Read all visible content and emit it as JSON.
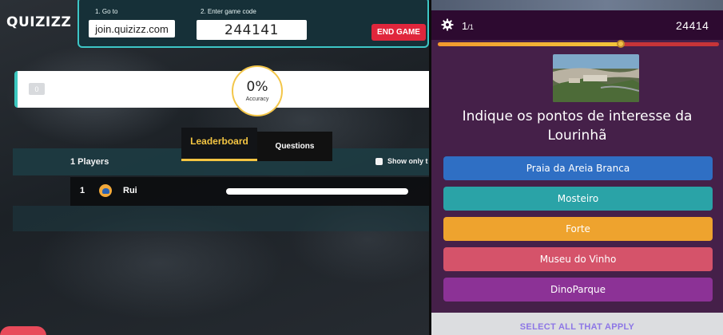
{
  "host": {
    "logo": "QUIZIZZ",
    "join": {
      "step1_label": "1. Go to",
      "step2_label": "2. Enter game code",
      "url": "join.quizizz.com",
      "code": "244141",
      "end_button": "END GAME"
    },
    "progress": {
      "chip": "0"
    },
    "accuracy": {
      "value": "0%",
      "label": "Accuracy"
    },
    "tabs": {
      "leaderboard": "Leaderboard",
      "questions": "Questions"
    },
    "leaderboard": {
      "players_count": "1 Players",
      "show_only": "Show only t",
      "rows": [
        {
          "rank": "1",
          "name": "Rui"
        }
      ]
    }
  },
  "player": {
    "question_index": "1",
    "question_total": "/1",
    "game_code": "24414",
    "timer_fraction": 0.65,
    "question": "Indique os pontos de interesse da Lourinhã",
    "options": [
      {
        "label": "Praia da Areia Branca",
        "color": "#2f6fc4"
      },
      {
        "label": "Mosteiro",
        "color": "#2aa3a7"
      },
      {
        "label": "Forte",
        "color": "#eea32e"
      },
      {
        "label": "Museu do Vinho",
        "color": "#d5536a"
      },
      {
        "label": "DinoParque",
        "color": "#8c3296"
      }
    ],
    "footer": "SELECT ALL THAT APPLY"
  },
  "colors": {
    "accent_teal": "#3dc6c6",
    "end_red": "#e0263c",
    "leaderboard_gold": "#f4c542",
    "player_bg": "#452049"
  }
}
